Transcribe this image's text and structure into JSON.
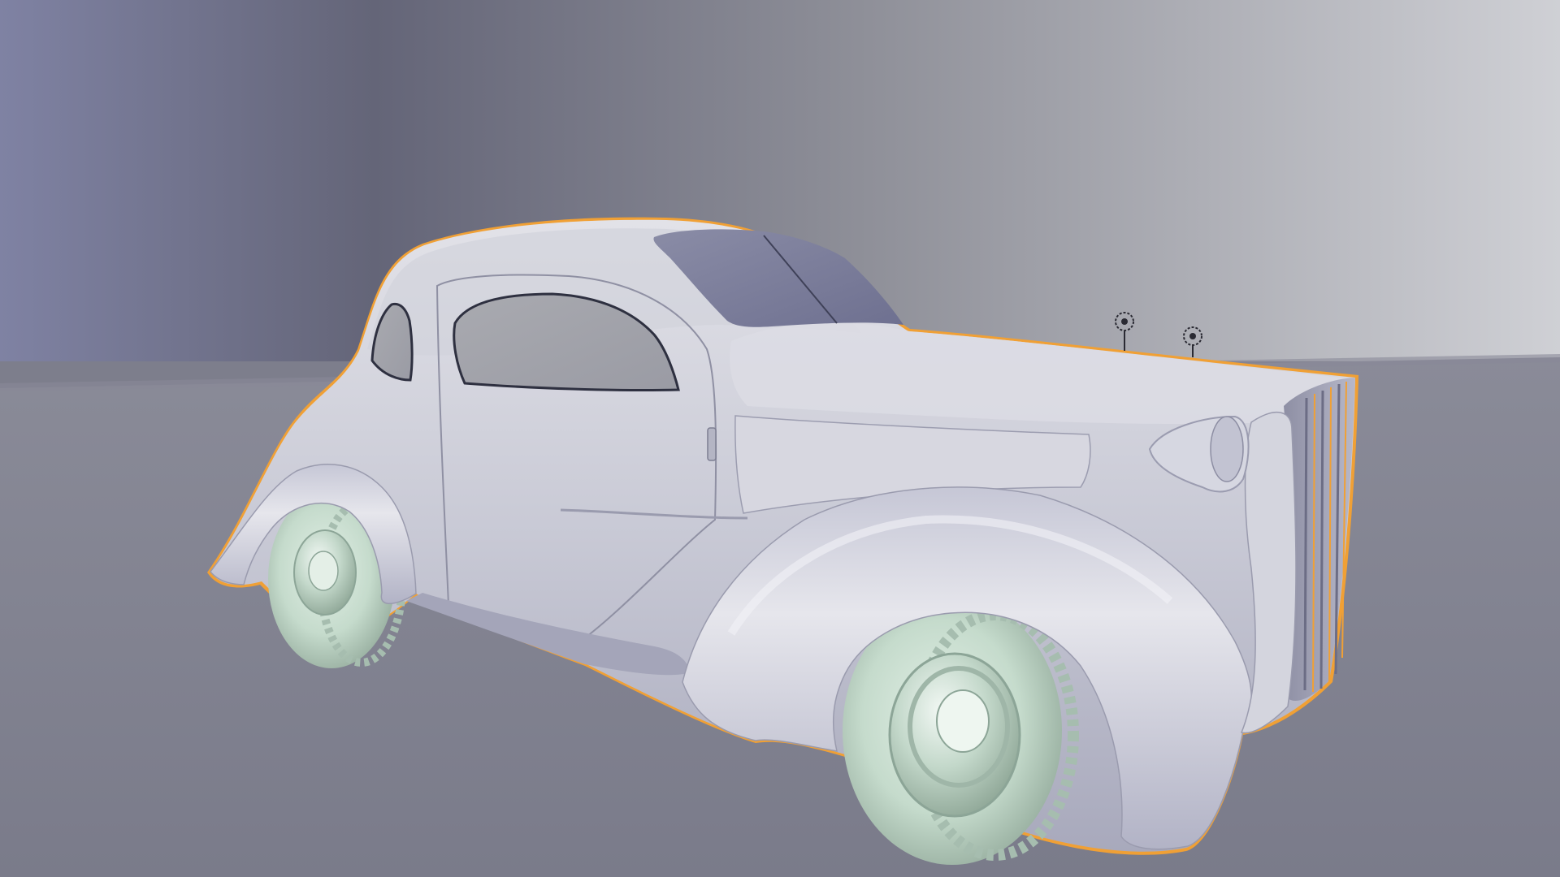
{
  "viewport": {
    "mode": "solid-shading",
    "selection_outline_color": "#f0a035",
    "background_colors": {
      "wall_left": "#7d80a0",
      "wall_mid": "#6a6b7e",
      "wall_right": "#c5c6cc",
      "floor": "#7d7e8c"
    }
  },
  "scene": {
    "selected_object": "car-body",
    "objects": [
      {
        "name": "car-body",
        "color": "#c9cad6",
        "selected": true
      },
      {
        "name": "front-wheel",
        "color": "#c6dccd"
      },
      {
        "name": "rear-wheel",
        "color": "#c6dccd"
      },
      {
        "name": "headlight",
        "color": "#cfd0da"
      },
      {
        "name": "radiator-grille",
        "color": "#9b9cad"
      }
    ],
    "lights": [
      {
        "name": "light-1",
        "icon": "light-point-icon"
      },
      {
        "name": "light-2",
        "icon": "light-point-icon"
      }
    ]
  }
}
